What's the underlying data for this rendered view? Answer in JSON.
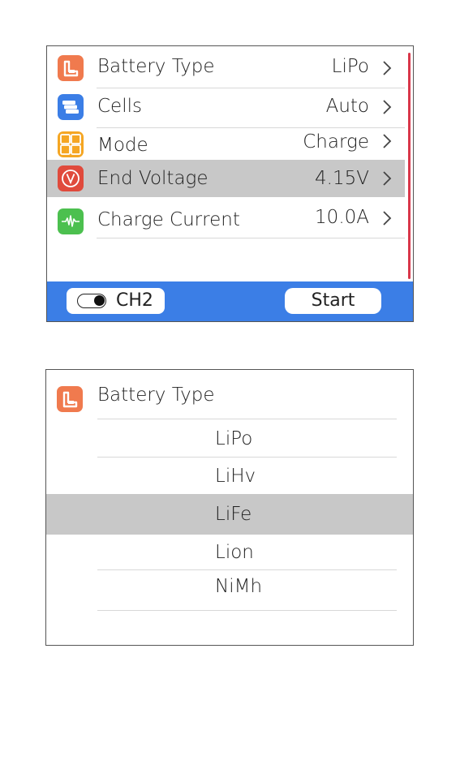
{
  "menu": {
    "items": [
      {
        "label": "Battery Type",
        "value": "LiPo",
        "icon": "battery-icon",
        "icon_color": "#f07a4e"
      },
      {
        "label": "Cells",
        "value": "Auto",
        "icon": "cells-stack-icon",
        "icon_color": "#3b7ee6"
      },
      {
        "label": "Mode",
        "value": "Charge",
        "icon": "mode-grid-icon",
        "icon_color": "#f5a623"
      },
      {
        "label": "End Voltage",
        "value": "4.15V",
        "icon": "voltage-icon",
        "icon_color": "#e04a3c",
        "selected": true
      },
      {
        "label": "Charge Current",
        "value": "10.0A",
        "icon": "current-wave-icon",
        "icon_color": "#4cc04f"
      }
    ],
    "scrollbar_color": "#d9374a"
  },
  "bottom_bar": {
    "color": "#3b7ee6",
    "channel_label": "CH2",
    "start_label": "Start"
  },
  "picker": {
    "title": "Battery Type",
    "icon": "battery-icon",
    "options": [
      "LiPo",
      "LiHv",
      "LiFe",
      "Lion",
      "NiMh"
    ],
    "selected": "LiFe"
  }
}
